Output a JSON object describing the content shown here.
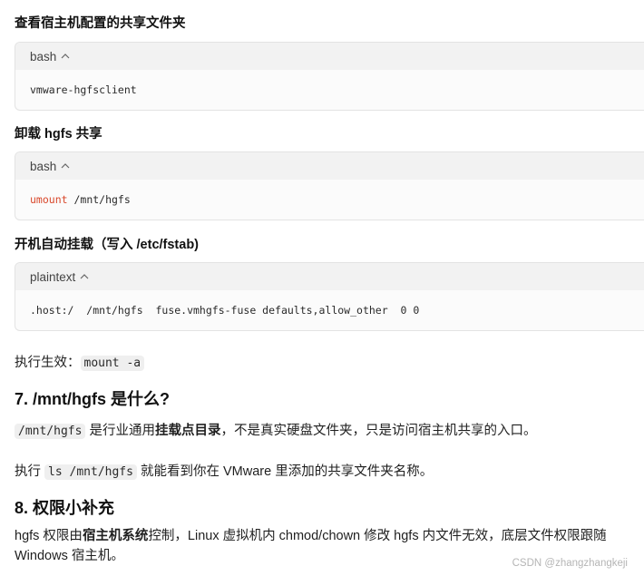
{
  "sections": {
    "view_share_title": "查看宿主机配置的共享文件夹",
    "block1": {
      "lang": "bash",
      "code": "vmware-hgfsclient"
    },
    "unmount_title": "卸载 hgfs 共享",
    "block2": {
      "lang": "bash",
      "keyword": "umount",
      "code": " /mnt/hgfs"
    },
    "automount_title": "开机自动挂载（写入 /etc/fstab)",
    "block3": {
      "lang": "plaintext",
      "code": ".host:/  /mnt/hgfs  fuse.vmhgfs-fuse defaults,allow_other  0 0"
    },
    "apply": {
      "prefix": "执行生效：",
      "code": "mount -a"
    },
    "q7_title": "7. /mnt/hgfs 是什么?",
    "q7_p1": {
      "code": "/mnt/hgfs",
      "text_a": " 是行业通用",
      "bold": "挂载点目录",
      "text_b": "，不是真实硬盘文件夹，只是访问宿主机共享的入口。"
    },
    "q7_p2": {
      "prefix": "执行 ",
      "code": "ls /mnt/hgfs",
      "suffix": " 就能看到你在 VMware 里添加的共享文件夹名称。"
    },
    "q8_title": "8. 权限小补充",
    "q8_p": {
      "prefix": "hgfs 权限由",
      "bold": "宿主机系统",
      "suffix": "控制，Linux 虚拟机内 chmod/chown 修改 hgfs 内文件无效，底层文件权限跟随 Windows 宿主机。"
    }
  },
  "watermark": "CSDN @zhangzhangkeji",
  "icons": {
    "collapse": "chevron-up-icon"
  }
}
